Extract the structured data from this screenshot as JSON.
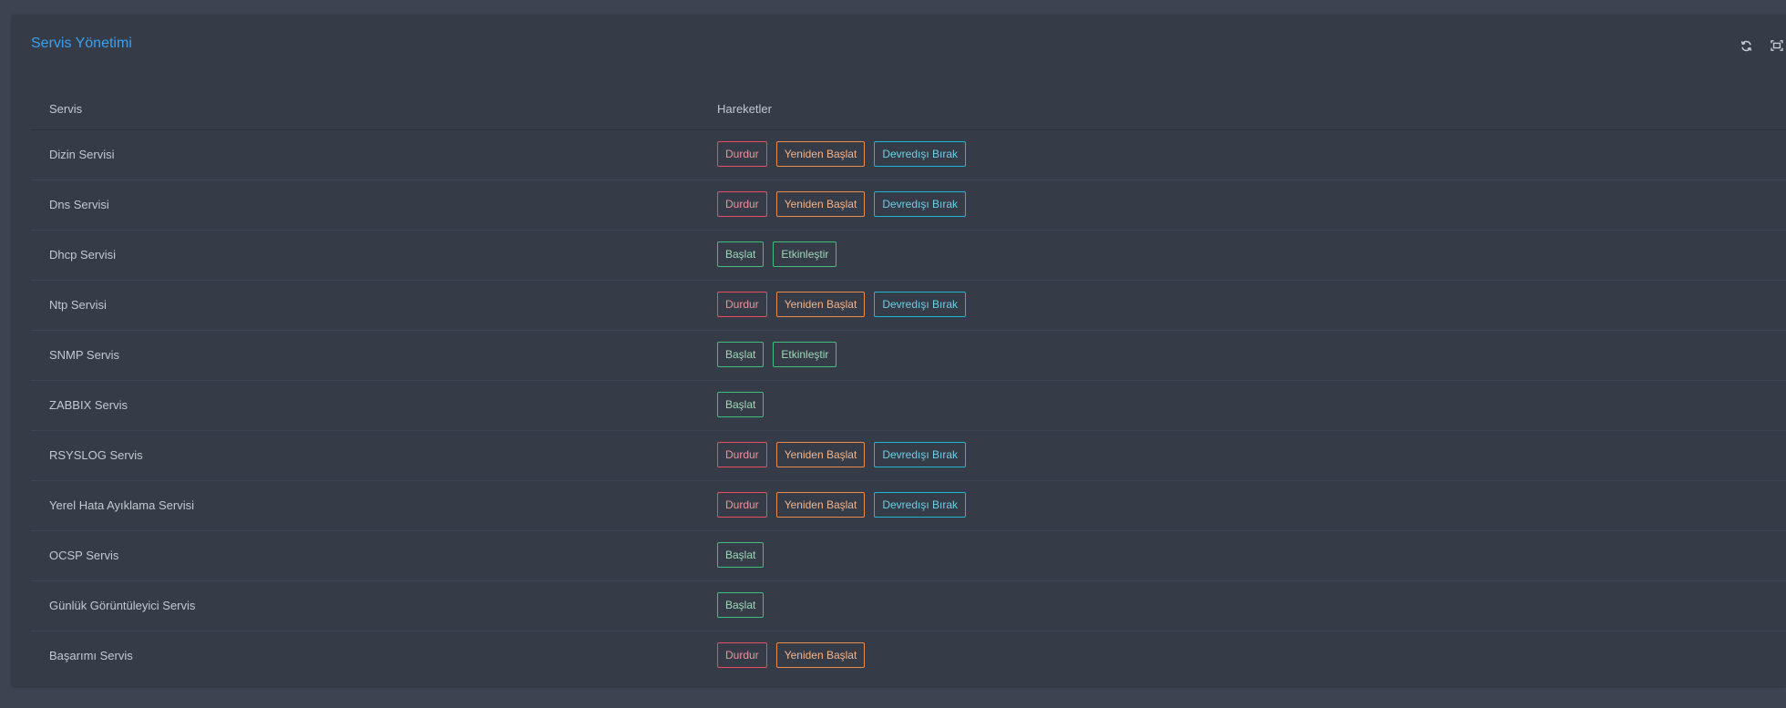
{
  "panel": {
    "title": "Servis Yönetimi",
    "tools": [
      {
        "icon": "refresh-icon"
      },
      {
        "icon": "expand-icon"
      }
    ]
  },
  "table": {
    "headers": {
      "service": "Servis",
      "actions": "Hareketler"
    },
    "rows": [
      {
        "name": "Dizin Servisi",
        "actions": [
          {
            "type": "stop",
            "label": "Durdur"
          },
          {
            "type": "restart",
            "label": "Yeniden Başlat"
          },
          {
            "type": "disable",
            "label": "Devredışı Bırak"
          }
        ]
      },
      {
        "name": "Dns Servisi",
        "actions": [
          {
            "type": "stop",
            "label": "Durdur"
          },
          {
            "type": "restart",
            "label": "Yeniden Başlat"
          },
          {
            "type": "disable",
            "label": "Devredışı Bırak"
          }
        ]
      },
      {
        "name": "Dhcp Servisi",
        "actions": [
          {
            "type": "start",
            "label": "Başlat"
          },
          {
            "type": "enable",
            "label": "Etkinleştir"
          }
        ]
      },
      {
        "name": "Ntp Servisi",
        "actions": [
          {
            "type": "stop",
            "label": "Durdur"
          },
          {
            "type": "restart",
            "label": "Yeniden Başlat"
          },
          {
            "type": "disable",
            "label": "Devredışı Bırak"
          }
        ]
      },
      {
        "name": "SNMP Servis",
        "actions": [
          {
            "type": "start",
            "label": "Başlat"
          },
          {
            "type": "enable",
            "label": "Etkinleştir"
          }
        ]
      },
      {
        "name": "ZABBIX Servis",
        "actions": [
          {
            "type": "start",
            "label": "Başlat"
          }
        ]
      },
      {
        "name": "RSYSLOG Servis",
        "actions": [
          {
            "type": "stop",
            "label": "Durdur"
          },
          {
            "type": "restart",
            "label": "Yeniden Başlat"
          },
          {
            "type": "disable",
            "label": "Devredışı Bırak"
          }
        ]
      },
      {
        "name": "Yerel Hata Ayıklama Servisi",
        "actions": [
          {
            "type": "stop",
            "label": "Durdur"
          },
          {
            "type": "restart",
            "label": "Yeniden Başlat"
          },
          {
            "type": "disable",
            "label": "Devredışı Bırak"
          }
        ]
      },
      {
        "name": "OCSP Servis",
        "actions": [
          {
            "type": "start",
            "label": "Başlat"
          }
        ]
      },
      {
        "name": "Günlük Görüntüleyici Servis",
        "actions": [
          {
            "type": "start",
            "label": "Başlat"
          }
        ]
      },
      {
        "name": "Başarımı Servis",
        "actions": [
          {
            "type": "stop",
            "label": "Durdur"
          },
          {
            "type": "restart",
            "label": "Yeniden Başlat"
          }
        ]
      }
    ]
  },
  "colors": {
    "background": "#3d4350",
    "panel": "#363b48",
    "title": "#3aa1f0",
    "stop": "#e5515f",
    "restart": "#ec8a4e",
    "disable": "#1fb5d5",
    "start": "#3fbe7d",
    "enable": "#3fbe7d"
  }
}
